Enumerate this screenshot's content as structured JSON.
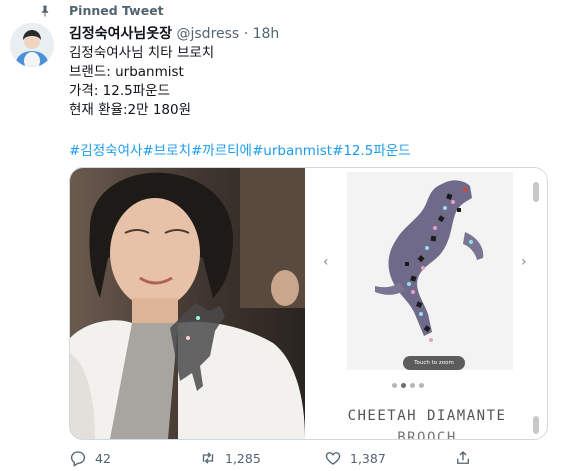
{
  "pinned": {
    "label": "Pinned Tweet",
    "icon": "pin-icon"
  },
  "tweet": {
    "display_name": "김정숙여사님옷장",
    "handle": "@jsdress",
    "separator": "·",
    "time": "18h",
    "lines": [
      "김정숙여사님 치타 브로치",
      "브랜드: urbanmist",
      "가격: 12.5파운드",
      "현재 환율:2만 180원"
    ],
    "hashtags": "#김정숙여사#브로치#까르티에#urbanmist#12.5파운드"
  },
  "media": {
    "zoom_hint": "Touch to zoom",
    "product_title_line1": "CHEETAH DIAMANTE",
    "product_title_line2": "BROOCH",
    "carousel_dots": 4,
    "active_dot": 1,
    "prev_icon": "chevron-left-icon",
    "next_icon": "chevron-right-icon"
  },
  "actions": {
    "reply_count": "42",
    "retweet_count": "1,285",
    "like_count": "1,387",
    "icons": [
      "reply-icon",
      "retweet-icon",
      "like-icon",
      "share-icon"
    ]
  },
  "colors": {
    "link": "#1d9bf0",
    "secondary_text": "#536471",
    "border": "#cfd9de"
  }
}
